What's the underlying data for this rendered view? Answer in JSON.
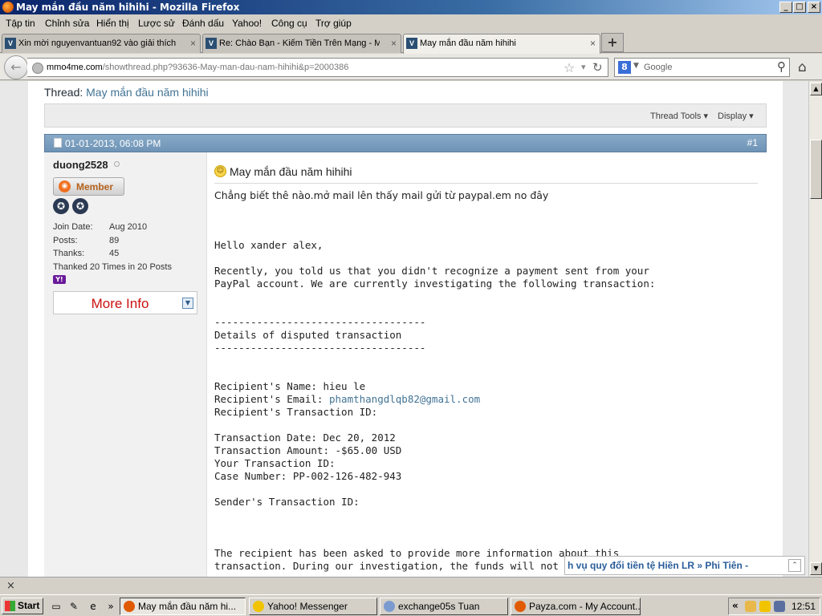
{
  "window": {
    "title": "May mắn đầu năm hihihi - Mozilla Firefox",
    "minimize": "_",
    "maximize": "□",
    "close": "×"
  },
  "menu": [
    "Tập tin",
    "Chỉnh sửa",
    "Hiển thị",
    "Lược sử",
    "Đánh dấu",
    "Yahoo!",
    "Công cụ",
    "Trợ giúp"
  ],
  "tabs": [
    {
      "label": "Xin mời nguyenvantuan92 vào giải thích ...",
      "close": "×"
    },
    {
      "label": "Re: Chào Bạn - Kiếm Tiền Trên Mạng - M...",
      "close": "×"
    },
    {
      "label": "May mắn đầu năm hihihi",
      "close": "×"
    }
  ],
  "new_tab": "+",
  "nav": {
    "url_domain": "mmo4me.com",
    "url_path": "/showthread.php?93636-May-man-dau-nam-hihihi&p=2000386",
    "search_engine": "8",
    "search_placeholder": "Google",
    "icons": {
      "back": "←",
      "star": "☆",
      "dropdown": "▾",
      "reload": "↻",
      "search": "⚲",
      "home": "⌂"
    }
  },
  "thread": {
    "prefix": "Thread:",
    "title": "May mắn đầu năm hihihi",
    "tools": "Thread Tools ▾",
    "display": "Display ▾"
  },
  "post": {
    "date": "01-01-2013, 06:08 PM",
    "number": "#1",
    "title": "May mắn đầu năm hihihi",
    "intro": "Chẳng biết thê nào.mở mail lên thấy mail gửi từ paypal.em no đây",
    "lines": [
      "Hello xander alex,",
      "",
      "Recently, you told us that you didn't recognize a payment sent from your",
      "PayPal account. We are currently investigating the following transaction:",
      "",
      "",
      "-----------------------------------",
      "Details of disputed transaction",
      "-----------------------------------",
      "",
      "",
      "Recipient's Name: hieu le",
      "Recipient's Email: ",
      "Recipient's Transaction ID:",
      "",
      "Transaction Date: Dec 20, 2012",
      "Transaction Amount: -$65.00 USD",
      "Your Transaction ID:",
      "Case Number: PP-002-126-482-943",
      "",
      "Sender's Transaction ID:",
      "",
      "",
      "",
      "The recipient has been asked to provide more information about this",
      "transaction. During our investigation, the funds will not be availab"
    ],
    "email_link": "phamthangdlqb82@gmail.com"
  },
  "user": {
    "name": "duong2528",
    "rank": "Member",
    "join_label": "Join Date:",
    "join_value": "Aug 2010",
    "posts_label": "Posts:",
    "posts_value": "89",
    "thanks_label": "Thanks:",
    "thanks_value": "45",
    "thanked": "Thanked 20 Times in 20 Posts",
    "more_info": "More Info"
  },
  "popup": {
    "text": "h vụ quy đổi tiền tệ Hiền LR     » Phi Tiên -"
  },
  "findbar": {
    "close": "×"
  },
  "taskbar": {
    "start": "Start",
    "chevron": "»",
    "tasks": [
      {
        "label": "May mắn đầu năm hi...",
        "color": "#e05a00"
      },
      {
        "label": "Yahoo! Messenger",
        "color": "#f2c400"
      },
      {
        "label": "exchange05s Tuan",
        "color": "#7b9bd0"
      },
      {
        "label": "Payza.com - My Account...",
        "color": "#e05a00"
      }
    ],
    "tray_chevron": "«",
    "clock": "12:51"
  }
}
